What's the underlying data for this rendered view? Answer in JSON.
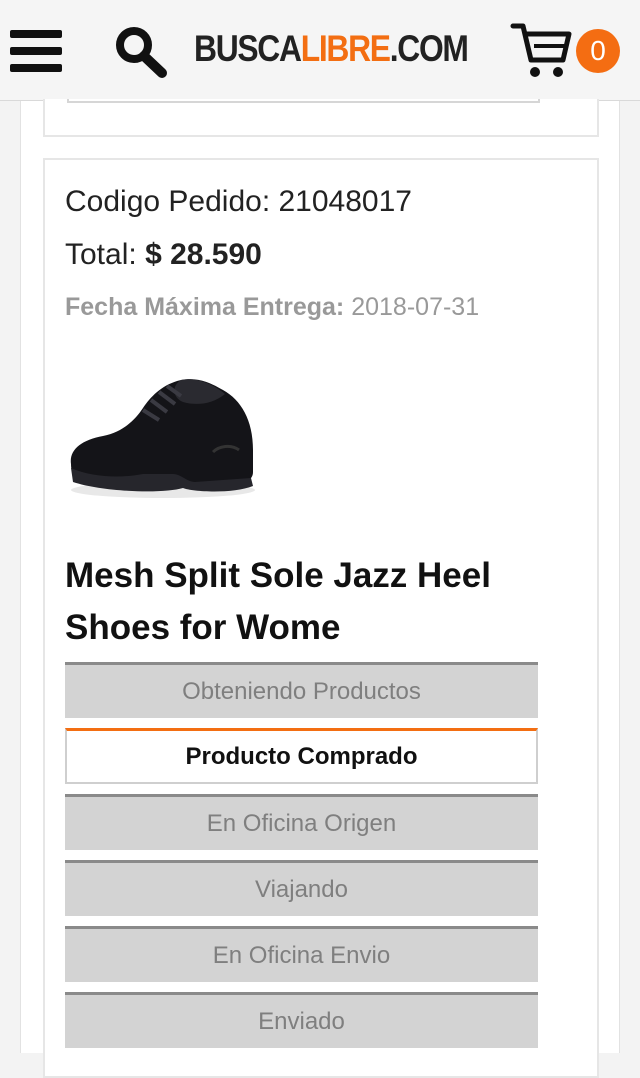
{
  "header": {
    "logo_part1": "BUSCA",
    "logo_part2": "LIBRE",
    "logo_part3": ".COM",
    "cart_count": "0",
    "accent_color": "#f36e12"
  },
  "order": {
    "code_label": "Codigo Pedido:",
    "code_value": "21048017",
    "total_label": "Total:",
    "total_value": "$ 28.590",
    "delivery_label": "Fecha Máxima Entrega:",
    "delivery_value": "2018-07-31",
    "product_title": "Mesh Split Sole Jazz Heel Shoes for Wome"
  },
  "status_steps": [
    {
      "label": "Obteniendo Productos",
      "active": false
    },
    {
      "label": "Producto Comprado",
      "active": true
    },
    {
      "label": "En Oficina Origen",
      "active": false
    },
    {
      "label": "Viajando",
      "active": false
    },
    {
      "label": "En Oficina Envio",
      "active": false
    },
    {
      "label": "Enviado",
      "active": false
    }
  ],
  "icons": {
    "menu": "hamburger-icon",
    "search": "search-icon",
    "cart": "cart-icon"
  }
}
